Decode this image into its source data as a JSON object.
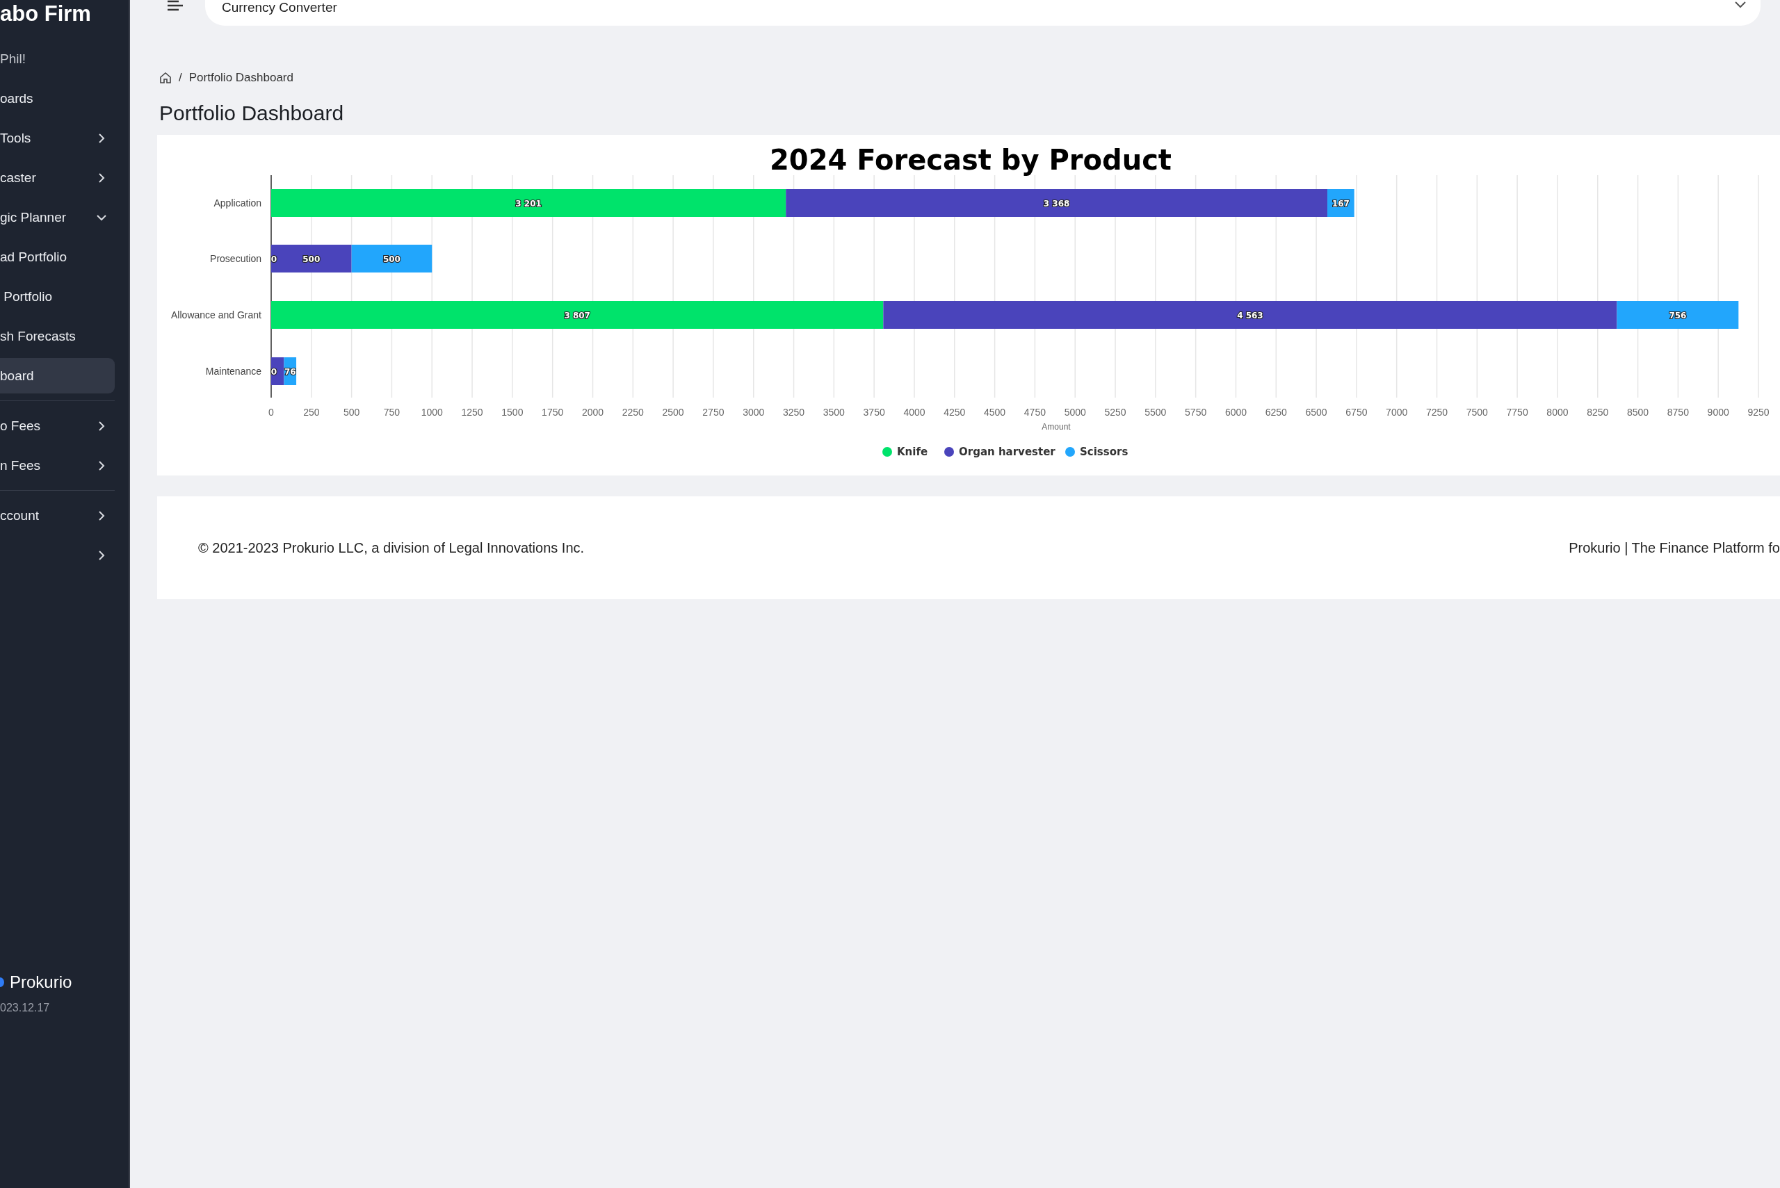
{
  "sidebar": {
    "title": "abo Firm",
    "greeting": "Phil!",
    "sections": [
      {
        "items": [
          {
            "label": "oards",
            "kind": "link",
            "selected": false
          },
          {
            "label": "Tools",
            "kind": "group",
            "expanded": false,
            "selected": false
          },
          {
            "label": "caster",
            "kind": "group",
            "expanded": false,
            "selected": false
          },
          {
            "label": "gic Planner",
            "kind": "group",
            "expanded": true,
            "selected": false
          },
          {
            "label": "ad Portfolio",
            "kind": "link",
            "selected": false
          },
          {
            "label": " Portfolio",
            "kind": "link",
            "selected": false
          },
          {
            "label": "sh Forecasts",
            "kind": "link",
            "selected": false
          },
          {
            "label": "board",
            "kind": "link",
            "selected": true
          }
        ]
      },
      {
        "items": [
          {
            "label": "o Fees",
            "kind": "group",
            "expanded": false,
            "selected": false
          },
          {
            "label": "n Fees",
            "kind": "group",
            "expanded": false,
            "selected": false
          }
        ]
      },
      {
        "items": [
          {
            "label": "ccount",
            "kind": "group",
            "expanded": false,
            "selected": false
          },
          {
            "kind": "group",
            "expanded": false,
            "selected": false
          }
        ]
      }
    ],
    "brand": "Prokurio",
    "version": "023.12.17"
  },
  "topbar": {
    "select_value": "Currency Converter"
  },
  "breadcrumb": {
    "separator": "/",
    "items": [
      "Portfolio Dashboard"
    ]
  },
  "page_title": "Portfolio Dashboard",
  "chart": {
    "chart_data": {
      "type": "bar",
      "orientation": "horizontal",
      "stacked": true,
      "grid": true,
      "legend": "bottom",
      "title": "2024 Forecast by Product",
      "xlabel": "Amount",
      "categories": [
        "Application",
        "Prosecution",
        "Allowance and Grant",
        "Maintenance"
      ],
      "series": [
        {
          "name": "Knife",
          "color": "#00e36b",
          "values": [
            3201,
            0,
            3807,
            0
          ],
          "value_labels": [
            "3 201",
            "0",
            "3 807",
            "0"
          ]
        },
        {
          "name": "Organ harvester",
          "color": "#4a44bb",
          "values": [
            3368,
            500,
            4563,
            80
          ],
          "value_labels": [
            "3 368",
            "500",
            "4 563",
            null
          ]
        },
        {
          "name": "Scissors",
          "color": "#22a6fc",
          "values": [
            167,
            500,
            756,
            76
          ],
          "value_labels": [
            "167",
            "500",
            "756",
            "76"
          ]
        }
      ],
      "xlim": [
        0,
        9250
      ],
      "xticks": [
        0,
        250,
        500,
        750,
        1000,
        1250,
        1500,
        1750,
        2000,
        2250,
        2500,
        2750,
        3000,
        3250,
        3500,
        3750,
        4000,
        4250,
        4500,
        4750,
        5000,
        5250,
        5500,
        5750,
        6000,
        6250,
        6500,
        6750,
        7000,
        7250,
        7500,
        7750,
        8000,
        8250,
        8500,
        8750,
        9000,
        9250
      ]
    }
  },
  "footer": {
    "copyright": "© 2021-2023 Prokurio LLC, a division of Legal Innovations Inc.",
    "tagline": "Prokurio | The Finance Platform fo"
  }
}
